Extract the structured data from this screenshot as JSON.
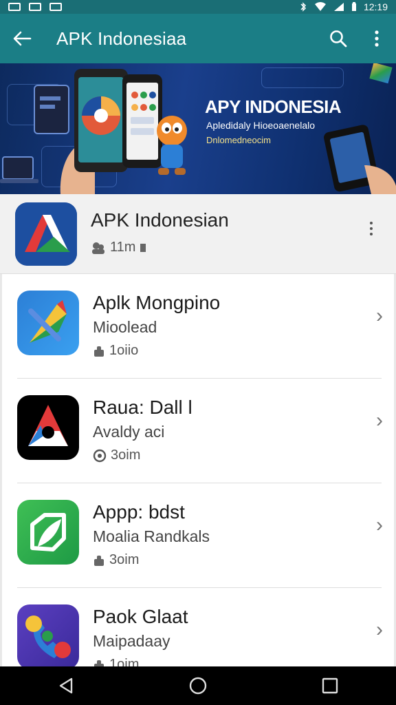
{
  "status": {
    "time": "12:19"
  },
  "app_bar": {
    "title": "APK Indonesiaa",
    "back_icon": "arrow-back-icon",
    "search_icon": "search-icon",
    "menu_icon": "more-vert-icon"
  },
  "banner": {
    "title": "APY INDONESIA",
    "subtitle": "Apledidaly Hioeoaenelalo",
    "tagline": "Dnlomedneocim"
  },
  "featured": {
    "name": "APK Indonesian",
    "meta": "11m"
  },
  "apps": [
    {
      "name": "Aplk Mongpino",
      "sub": "Mioolead",
      "meta": "1oiio",
      "icon": "pin-icon"
    },
    {
      "name": "Raua: Dall l",
      "sub": "Avaldy aci",
      "meta": "3oim",
      "icon": "a-logo-icon"
    },
    {
      "name": "Appp: bdst",
      "sub": "Moalia Randkals",
      "meta": "3oim",
      "icon": "leaf-icon"
    },
    {
      "name": "Paok Glaat",
      "sub": "Maipadaay",
      "meta": "1oim",
      "icon": "phone-icon"
    }
  ],
  "colors": {
    "app_bar": "#1b7e86",
    "status_bar": "#1a6e75",
    "banner_bg": "#1a3f8c",
    "nav_bar": "#000000"
  }
}
